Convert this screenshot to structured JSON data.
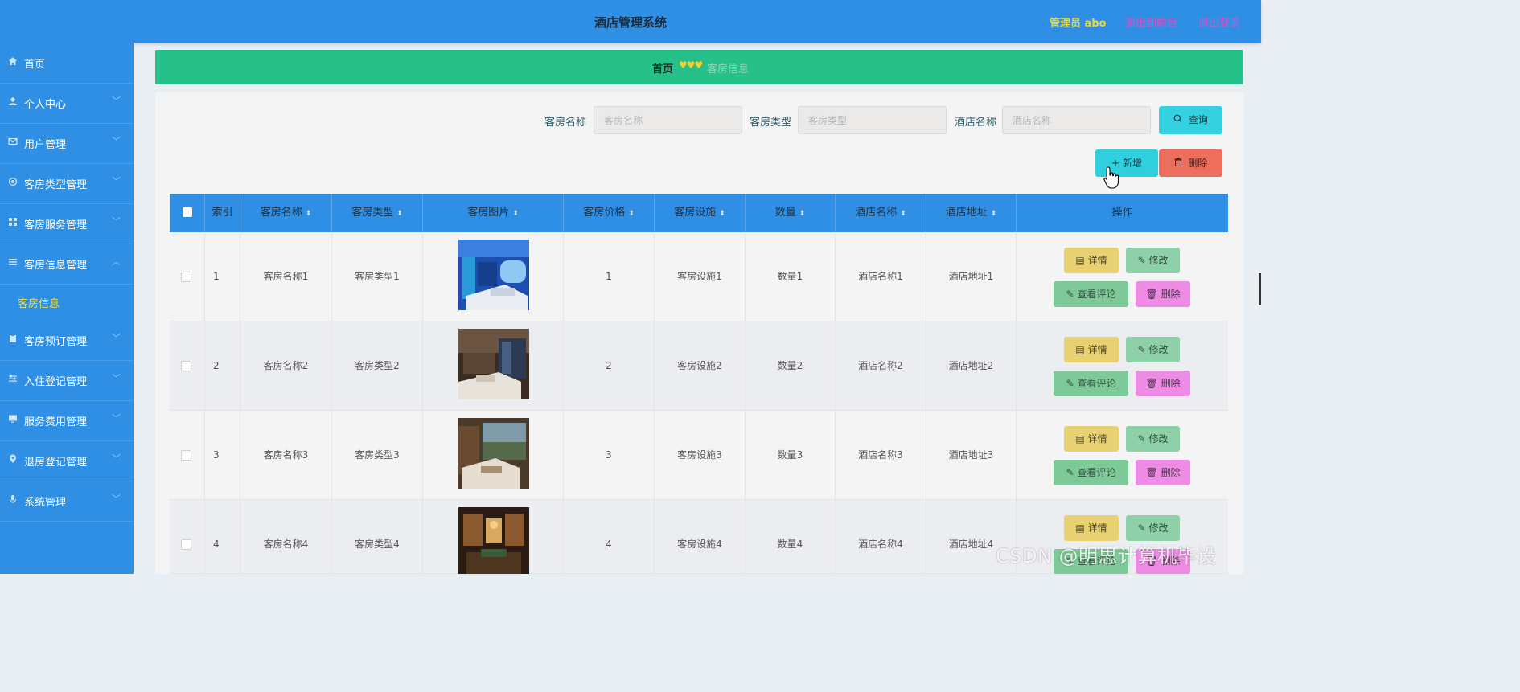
{
  "header": {
    "title": "酒店管理系统",
    "admin": "管理员 abo",
    "back_front": "退出到前台",
    "logout": "退出登录"
  },
  "sidebar": {
    "items": [
      {
        "label": "首页",
        "icon": "home-icon"
      },
      {
        "label": "个人中心",
        "icon": "user-icon"
      },
      {
        "label": "用户管理",
        "icon": "mail-icon"
      },
      {
        "label": "客房类型管理",
        "icon": "circle-icon"
      },
      {
        "label": "客房服务管理",
        "icon": "grid-icon"
      },
      {
        "label": "客房信息管理",
        "icon": "list-icon"
      },
      {
        "label": "客房预订管理",
        "icon": "clipboard-icon"
      },
      {
        "label": "入住登记管理",
        "icon": "sliders-icon"
      },
      {
        "label": "服务费用管理",
        "icon": "monitor-icon"
      },
      {
        "label": "退房登记管理",
        "icon": "location-icon"
      },
      {
        "label": "系统管理",
        "icon": "mic-icon"
      }
    ],
    "submenu": {
      "label": "客房信息"
    }
  },
  "breadcrumb": {
    "home": "首页",
    "separator": "♥♥♥",
    "current": "客房信息"
  },
  "filters": {
    "room_name": {
      "label": "客房名称",
      "placeholder": "客房名称"
    },
    "room_type": {
      "label": "客房类型",
      "placeholder": "客房类型"
    },
    "hotel_name": {
      "label": "酒店名称",
      "placeholder": "酒店名称"
    },
    "search_button": "查询"
  },
  "actions": {
    "add": "新增",
    "delete": "删除"
  },
  "table": {
    "columns": [
      "索引",
      "客房名称",
      "客房类型",
      "客房图片",
      "客房价格",
      "客房设施",
      "数量",
      "酒店名称",
      "酒店地址",
      "操作"
    ],
    "rows": [
      {
        "index": "1",
        "name": "客房名称1",
        "type": "客房类型1",
        "price": "1",
        "facility": "客房设施1",
        "qty": "数量1",
        "hotel": "酒店名称1",
        "address": "酒店地址1"
      },
      {
        "index": "2",
        "name": "客房名称2",
        "type": "客房类型2",
        "price": "2",
        "facility": "客房设施2",
        "qty": "数量2",
        "hotel": "酒店名称2",
        "address": "酒店地址2"
      },
      {
        "index": "3",
        "name": "客房名称3",
        "type": "客房类型3",
        "price": "3",
        "facility": "客房设施3",
        "qty": "数量3",
        "hotel": "酒店名称3",
        "address": "酒店地址3"
      },
      {
        "index": "4",
        "name": "客房名称4",
        "type": "客房类型4",
        "price": "4",
        "facility": "客房设施4",
        "qty": "数量4",
        "hotel": "酒店名称4",
        "address": "酒店地址4"
      }
    ],
    "row_buttons": {
      "detail": "详情",
      "edit": "修改",
      "review": "查看评论",
      "delete": "删除"
    }
  },
  "watermark": "CSDN @明思计算机毕设",
  "colors": {
    "topbar": "#2f8fe4",
    "breadcrumb": "#27c08a",
    "accent_yellow": "#e8d63a",
    "link_pink": "#e34dc6"
  }
}
